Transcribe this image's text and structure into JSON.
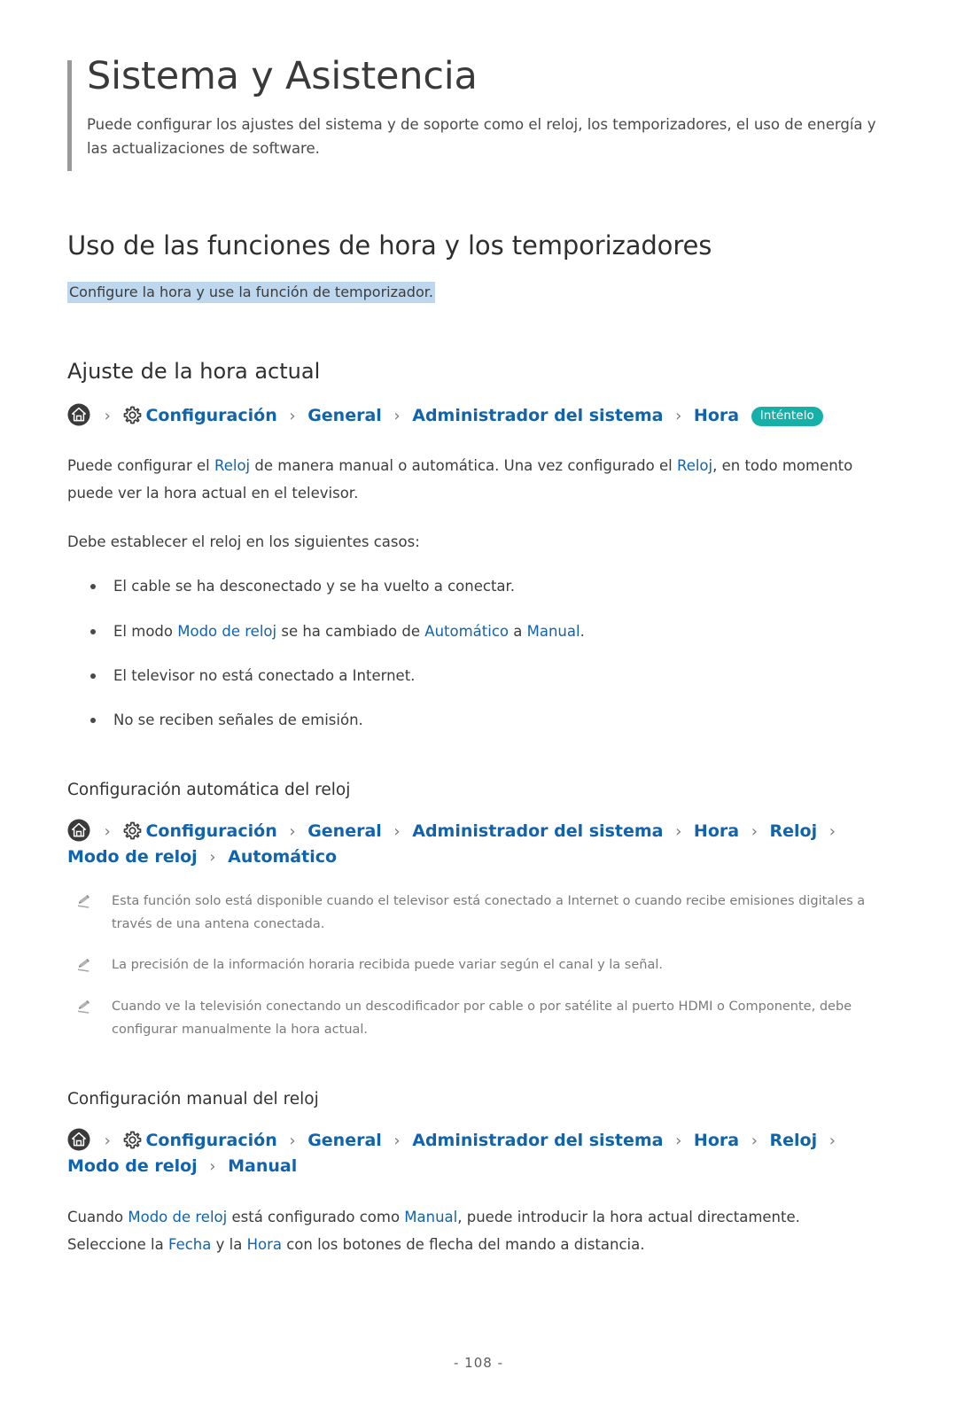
{
  "document": {
    "title": "Sistema y Asistencia",
    "subtitle": "Puede configurar los ajustes del sistema y de soporte como el reloj, los temporizadores, el uso de energía y las actualizaciones de software.",
    "page_number": "- 108 -"
  },
  "section": {
    "heading": "Uso de las funciones de hora y los temporizadores",
    "highlighted_note": "Configure la hora y use la función de temporizador.",
    "highlight_color": "#bdd7ee"
  },
  "colors": {
    "link_blue": "#1263ad",
    "badge_teal": "#17b0a8",
    "title_gray": "#3a3a3a",
    "note_gray": "#7a7a7a",
    "rule_gray": "#9a9a9a"
  },
  "sub_section_1": {
    "heading": "Ajuste de la hora actual",
    "breadcrumb": {
      "home_icon": "home-icon",
      "gear_icon": "gear-icon",
      "separator": "›",
      "items": [
        "Configuración",
        "General",
        "Administrador del sistema",
        "Hora"
      ],
      "badge": "Inténtelo"
    },
    "paragraph_1": {
      "part_1": "Puede configurar el ",
      "link_1": "Reloj",
      "part_2": " de manera manual o automática. Una vez configurado el ",
      "link_2": "Reloj",
      "part_3": ", en todo momento puede ver la hora actual en el televisor."
    },
    "paragraph_2": "Debe establecer el reloj en los siguientes casos:",
    "bullets": [
      {
        "text": "El cable se ha desconectado y se ha vuelto a conectar."
      },
      {
        "part_1": "El modo ",
        "link_1": "Modo de reloj",
        "part_2": " se ha cambiado de ",
        "link_2": "Automático",
        "part_3": " a ",
        "link_3": "Manual",
        "part_4": "."
      },
      {
        "text": "El televisor no está conectado a Internet."
      },
      {
        "text": "No se reciben señales de emisión."
      }
    ]
  },
  "sub_section_2": {
    "heading": "Configuración automática del reloj",
    "breadcrumb": {
      "items": [
        "Configuración",
        "General",
        "Administrador del sistema",
        "Hora",
        "Reloj",
        "Modo de reloj",
        "Automático"
      ]
    },
    "notes": [
      "Esta función solo está disponible cuando el televisor está conectado a Internet o cuando recibe emisiones digitales a través de una antena conectada.",
      "La precisión de la información horaria recibida puede variar según el canal y la señal.",
      "Cuando ve la televisión conectando un descodificador por cable o por satélite al puerto HDMI o Componente, debe configurar manualmente la hora actual."
    ]
  },
  "sub_section_3": {
    "heading": "Configuración manual del reloj",
    "breadcrumb": {
      "items": [
        "Configuración",
        "General",
        "Administrador del sistema",
        "Hora",
        "Reloj",
        "Modo de reloj",
        "Manual"
      ]
    },
    "paragraph": {
      "part_1": "Cuando ",
      "link_1": "Modo de reloj",
      "part_2": " está configurado como ",
      "link_2": "Manual",
      "part_3": ", puede introducir la hora actual directamente. Seleccione la ",
      "link_3": "Fecha",
      "part_4": " y la ",
      "link_4": "Hora",
      "part_5": " con los botones de flecha del mando a distancia."
    }
  }
}
